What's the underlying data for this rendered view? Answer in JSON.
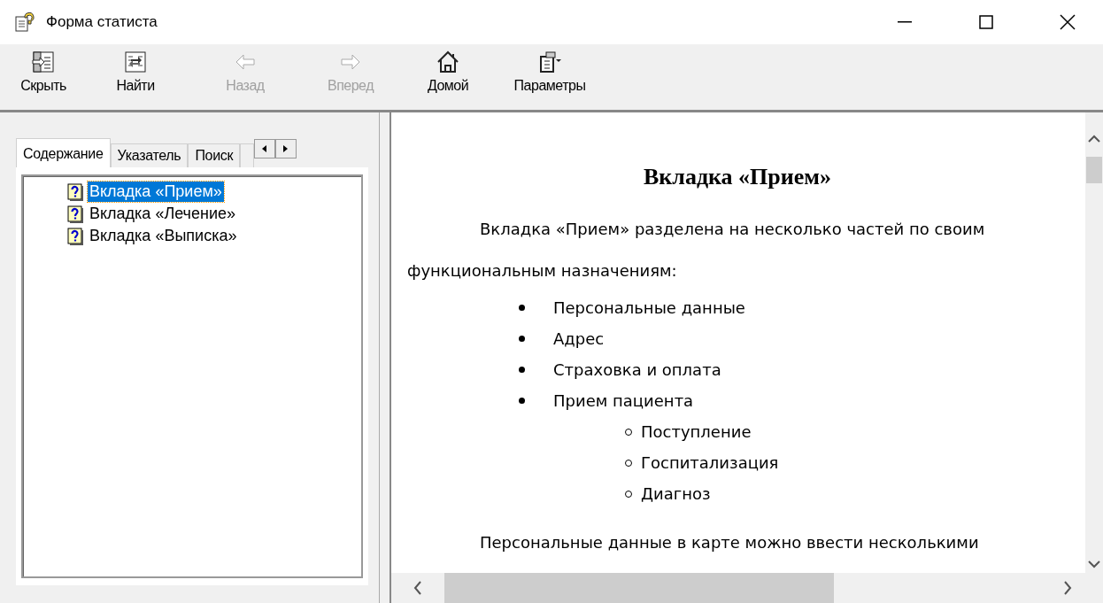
{
  "window": {
    "title": "Форма статиста"
  },
  "toolbar": [
    {
      "label": "Скрыть",
      "kind": "hide",
      "disabled": false
    },
    {
      "label": "Найти",
      "kind": "find",
      "disabled": false
    },
    {
      "label": "Назад",
      "kind": "back",
      "disabled": true
    },
    {
      "label": "Вперед",
      "kind": "forward",
      "disabled": true
    },
    {
      "label": "Домой",
      "kind": "home",
      "disabled": false
    },
    {
      "label": "Параметры",
      "kind": "options",
      "disabled": false
    }
  ],
  "tabs": [
    {
      "label": "Содержание",
      "selected": true
    },
    {
      "label": "Указатель",
      "selected": false
    },
    {
      "label": "Поиск",
      "selected": false
    }
  ],
  "tree": [
    {
      "label": "Вкладка «Прием»",
      "selected": true
    },
    {
      "label": "Вкладка «Лечение»",
      "selected": false
    },
    {
      "label": "Вкладка «Выписка»",
      "selected": false
    }
  ],
  "content": {
    "heading": "Вкладка «Прием»",
    "intro": "Вкладка «Прием» разделена на несколько частей по своим функциональным назначениям:",
    "list": [
      {
        "text": "Персональные данные"
      },
      {
        "text": "Адрес"
      },
      {
        "text": "Страховка и оплата"
      },
      {
        "text": "Прием пациента",
        "children": [
          {
            "text": "Поступление"
          },
          {
            "text": "Госпитализация"
          },
          {
            "text": "Диагноз"
          }
        ]
      }
    ],
    "next": "Персональные данные в карте можно ввести несколькими"
  }
}
